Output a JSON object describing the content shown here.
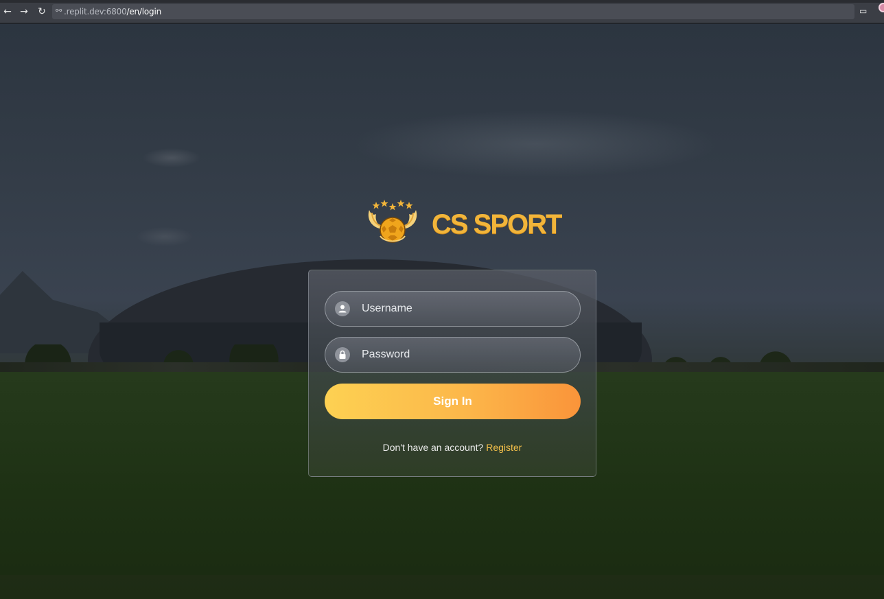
{
  "browser": {
    "url_host": ".replit.dev:6800",
    "url_path": "/en/login"
  },
  "brand": {
    "name": "CS SPORT",
    "accent_color": "#f2b53a"
  },
  "login_form": {
    "username_placeholder": "Username",
    "password_placeholder": "Password",
    "submit_label": "Sign In",
    "register_prompt": "Don't have an account?",
    "register_link": "Register"
  },
  "colors": {
    "button_gradient_start": "#fdd152",
    "button_gradient_end": "#fa943a",
    "link": "#f5c04a"
  }
}
